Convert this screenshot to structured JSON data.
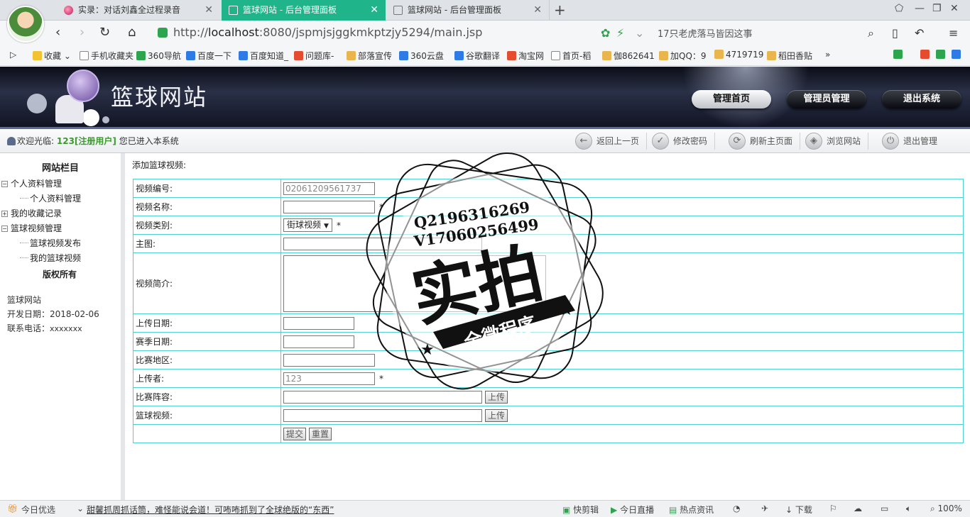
{
  "browser": {
    "tabs": [
      {
        "title": "实录：对话刘鑫全过程录音",
        "active": false
      },
      {
        "title": "篮球网站 - 后台管理面板",
        "active": true
      },
      {
        "title": "篮球网站 - 后台管理面板",
        "active": false
      }
    ],
    "url_prefix": "http://",
    "url_host": "localhost",
    "url_rest": ":8080/jspmjsjggkmkptzjy5294/main.jsp",
    "search_hint": "17只老虎落马皆因这事",
    "bookmarks": [
      "收藏",
      "手机收藏夹",
      "360导航",
      "百度一下",
      "百度知道_",
      "问题库-",
      "部落宣传",
      "360云盘",
      "谷歌翻译",
      "淘宝网",
      "首页-稻",
      "伽862641",
      "加QQ：9",
      "4719719",
      "稻田香贴"
    ]
  },
  "site": {
    "title": "篮球网站",
    "nav": [
      "管理首页",
      "管理员管理",
      "退出系统"
    ]
  },
  "status": {
    "welcome_prefix": "欢迎光临:",
    "user": "123[注册用户]",
    "welcome_suffix": "您已进入本系统",
    "tools": [
      "返回上一页",
      "修改密码",
      "刷新主页面",
      "浏览网站",
      "退出管理"
    ]
  },
  "sidebar": {
    "heading": "网站栏目",
    "tree": [
      {
        "label": "个人资料管理",
        "expanded": true
      },
      {
        "label": "个人资料管理",
        "child": true
      },
      {
        "label": "我的收藏记录",
        "expanded": false
      },
      {
        "label": "篮球视频管理",
        "expanded": true
      },
      {
        "label": "篮球视频发布",
        "child": true
      },
      {
        "label": "我的篮球视频",
        "child": true
      }
    ],
    "copyright": "版权所有",
    "site_name": "篮球网站",
    "dev_date": "开发日期：2018-02-06",
    "phone_label": "联系电话：",
    "phone": "xxxxxxx"
  },
  "form": {
    "heading": "添加篮球视频:",
    "fields": {
      "id_label": "视频编号:",
      "id_value": "02061209561737",
      "name_label": "视频名称:",
      "type_label": "视频类别:",
      "type_value": "街球视频",
      "image_label": "主图:",
      "intro_label": "视频简介:",
      "upload_date_label": "上传日期:",
      "season_date_label": "赛季日期:",
      "region_label": "比赛地区:",
      "uploader_label": "上传者:",
      "uploader_value": "123",
      "lineup_label": "比赛阵容:",
      "video_label": "篮球视频:"
    },
    "required_mark": "*",
    "upload_btn": "上传",
    "submit_btn": "提交",
    "reset_btn": "重置"
  },
  "watermark": {
    "line1": "Q2196316269",
    "line2": "V17060256499",
    "main": "实拍",
    "banner": "全微程序"
  },
  "bottom": {
    "left": "今日优选",
    "news": "甜馨抓周抓话筒，难怪能说会道！可咘咘抓到了全球绝版的“东西”",
    "items": [
      "快剪辑",
      "今日直播",
      "热点资讯",
      "下载"
    ],
    "zoom": "100%"
  }
}
